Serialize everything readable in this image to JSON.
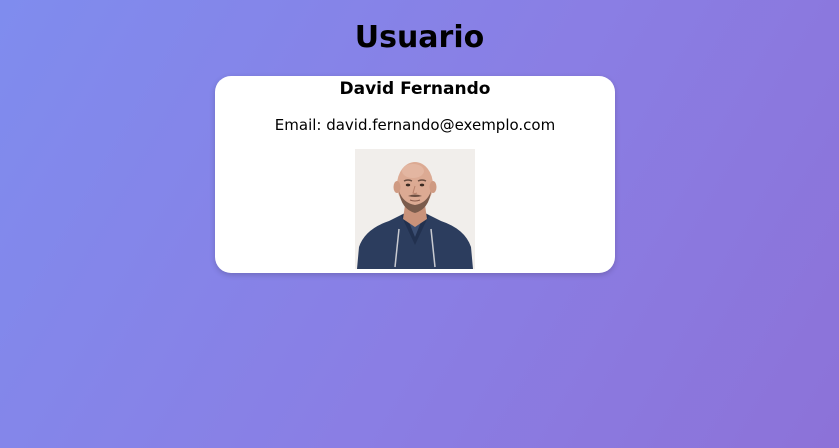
{
  "page": {
    "title": "Usuario"
  },
  "user": {
    "name": "David Fernando",
    "email_label": "Email: david.fernando@exemplo.com",
    "photo_alt": "David Fernando"
  },
  "colors": {
    "background_start": "#7f8cee",
    "background_end": "#8c72d8",
    "card_background": "#ffffff"
  }
}
